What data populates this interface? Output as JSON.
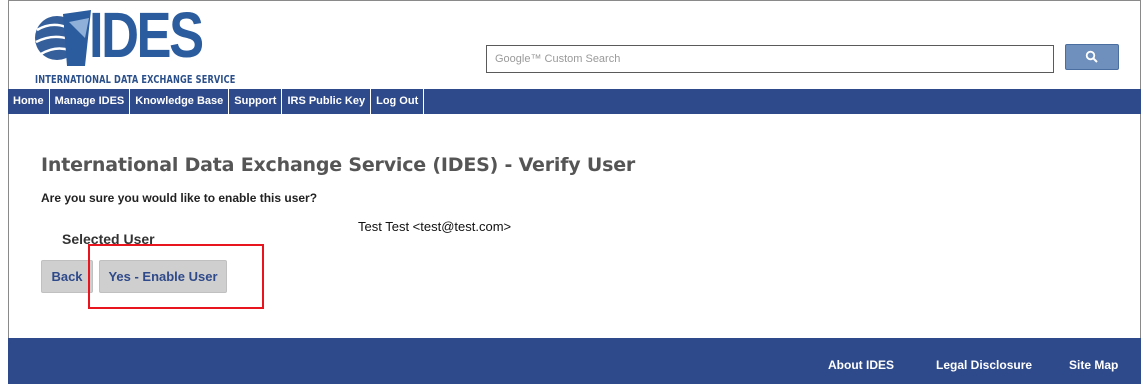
{
  "header": {
    "logo_text": "IDES",
    "logo_subtitle": "INTERNATIONAL DATA EXCHANGE SERVICE",
    "search_placeholder": "Google™ Custom Search",
    "search_button_icon": "magnifier-icon"
  },
  "nav": {
    "items": [
      {
        "label": "Home"
      },
      {
        "label": "Manage IDES"
      },
      {
        "label": "Knowledge Base"
      },
      {
        "label": "Support"
      },
      {
        "label": "IRS Public Key"
      },
      {
        "label": "Log Out"
      }
    ]
  },
  "main": {
    "title": "International Data Exchange Service (IDES) - Verify User",
    "question": "Are you sure you would like to enable this user?",
    "selected_user_label": "Selected User",
    "selected_user_value": "Test Test <test@test.com>",
    "back_label": "Back",
    "enable_label": "Yes - Enable User"
  },
  "footer": {
    "links": [
      {
        "label": "About IDES"
      },
      {
        "label": "Legal Disclosure"
      },
      {
        "label": "Site Map"
      }
    ]
  },
  "colors": {
    "nav_bg": "#2f4a8a",
    "highlight": "#e8141e",
    "button_bg": "#cfcfcf"
  }
}
